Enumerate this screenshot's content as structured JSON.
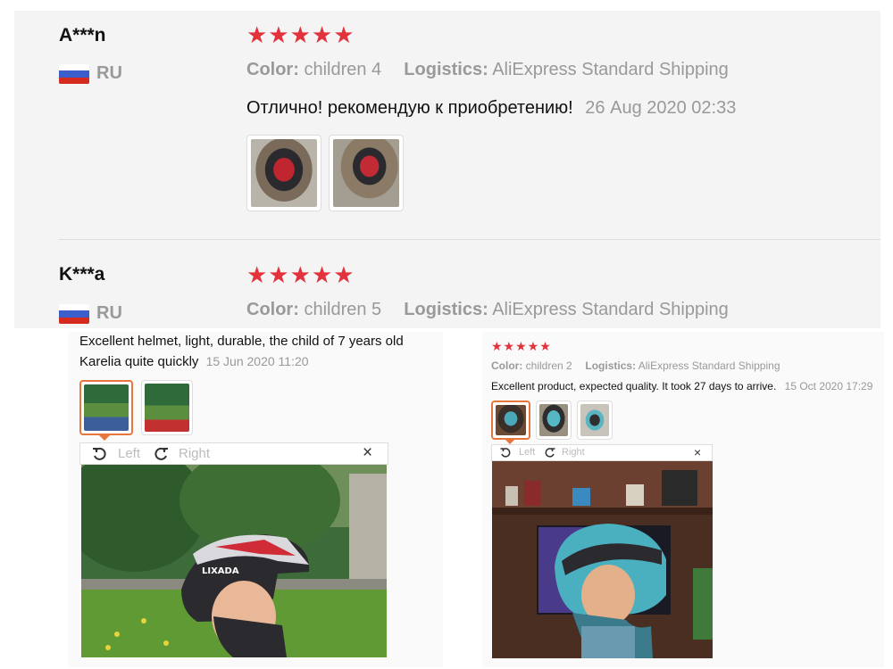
{
  "reviews_top": [
    {
      "name": "A***n",
      "country": "RU",
      "stars": "★★★★★",
      "color_label": "Color:",
      "color_value": "children 4",
      "logistics_label": "Logistics:",
      "logistics_value": "AliExpress Standard Shipping",
      "text": "Отлично! рекомендую к приобретению!",
      "date": "26 Aug 2020 02:33"
    },
    {
      "name": "K***a",
      "country": "RU",
      "stars": "★★★★★",
      "color_label": "Color:",
      "color_value": "children 5",
      "logistics_label": "Logistics:",
      "logistics_value": "AliExpress Standard Shipping"
    }
  ],
  "review_left": {
    "text_line1": "Excellent helmet, light, durable, the child of 7 years old",
    "text_line2": "Karelia quite quickly",
    "date": "15 Jun 2020 11:20",
    "viewer": {
      "left_label": "Left",
      "right_label": "Right",
      "close": "×"
    },
    "photo_brand": "LIXADA"
  },
  "review_right": {
    "stars": "★★★★★",
    "color_label": "Color:",
    "color_value": "children 2",
    "logistics_label": "Logistics:",
    "logistics_value": "AliExpress Standard Shipping",
    "text": "Excellent product, expected quality. It took 27 days to arrive.",
    "date": "15 Oct 2020 17:29",
    "viewer": {
      "left_label": "Left",
      "right_label": "Right",
      "close": "×"
    }
  },
  "colors": {
    "star": "#e2323c",
    "active_thumb": "#e8753b",
    "panel_bg": "#f4f4f4",
    "muted_text": "#999999"
  },
  "icons": [
    "flag-ru-icon",
    "rotate-left-icon",
    "rotate-right-icon",
    "close-icon"
  ]
}
